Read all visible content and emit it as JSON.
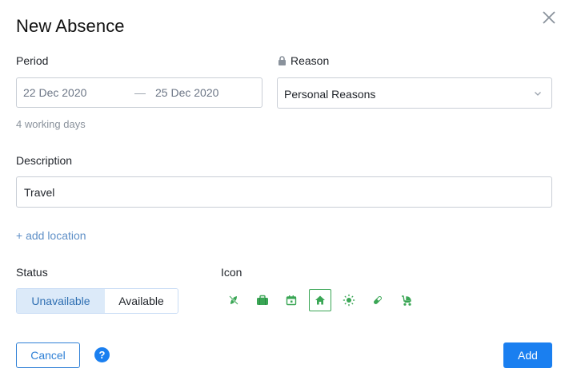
{
  "dialog": {
    "title": "New Absence"
  },
  "period": {
    "label": "Period",
    "from": "22 Dec 2020",
    "dash": "—",
    "to": "25 Dec 2020",
    "working_days": "4 working days"
  },
  "reason": {
    "label": "Reason",
    "value": "Personal Reasons",
    "lock_icon": "lock-icon"
  },
  "description": {
    "label": "Description",
    "value": "Travel"
  },
  "add_location": "+ add location",
  "status": {
    "label": "Status",
    "options": [
      "Unavailable",
      "Available"
    ],
    "selected": "Unavailable"
  },
  "icon_picker": {
    "label": "Icon",
    "icons": [
      "no-travel-icon",
      "briefcase-icon",
      "calendar-icon",
      "home-icon",
      "sun-icon",
      "pill-icon",
      "stroller-icon"
    ],
    "selected": "home-icon",
    "color": "#3aa655"
  },
  "footer": {
    "cancel_label": "Cancel",
    "help_label": "?",
    "add_label": "Add"
  },
  "colors": {
    "accent": "#1a7ff0",
    "icon_green": "#3aa655",
    "toggle_selected_bg": "#dceaf9"
  }
}
